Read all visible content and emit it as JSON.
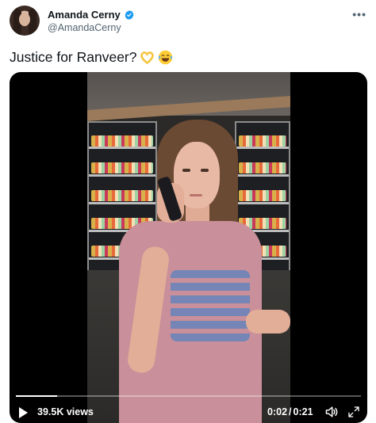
{
  "author": {
    "display_name": "Amanda Cerny",
    "handle": "@AmandaCerny",
    "verified": true,
    "verified_color": "#1d9bf0"
  },
  "tweet": {
    "text": "Justice for Ranveer?",
    "emojis": [
      "heart-hands-emoji",
      "tears-of-joy-emoji"
    ]
  },
  "video": {
    "views": "39.5K views",
    "current_time": "0:02",
    "separator": "/",
    "duration": "0:21",
    "progress_fraction": 0.12
  },
  "icons": {
    "more": "more-options-icon",
    "play": "play-icon",
    "volume": "volume-icon",
    "expand": "expand-icon"
  }
}
